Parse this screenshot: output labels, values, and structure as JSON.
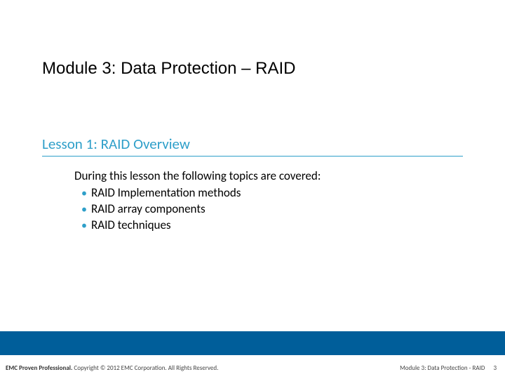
{
  "module_title": "Module 3: Data Protection – RAID",
  "lesson_title": "Lesson 1: RAID Overview",
  "body": {
    "intro": "During this lesson the following topics are covered:",
    "bullets": [
      "RAID Implementation methods",
      "RAID array components",
      "RAID techniques"
    ]
  },
  "footer": {
    "left_bold": "EMC Proven Professional.",
    "left_rest": " Copyright © 2012 EMC Corporation. All Rights Reserved.",
    "right_module": "Module 3: Data Protection - RAID",
    "page_number": "3"
  }
}
